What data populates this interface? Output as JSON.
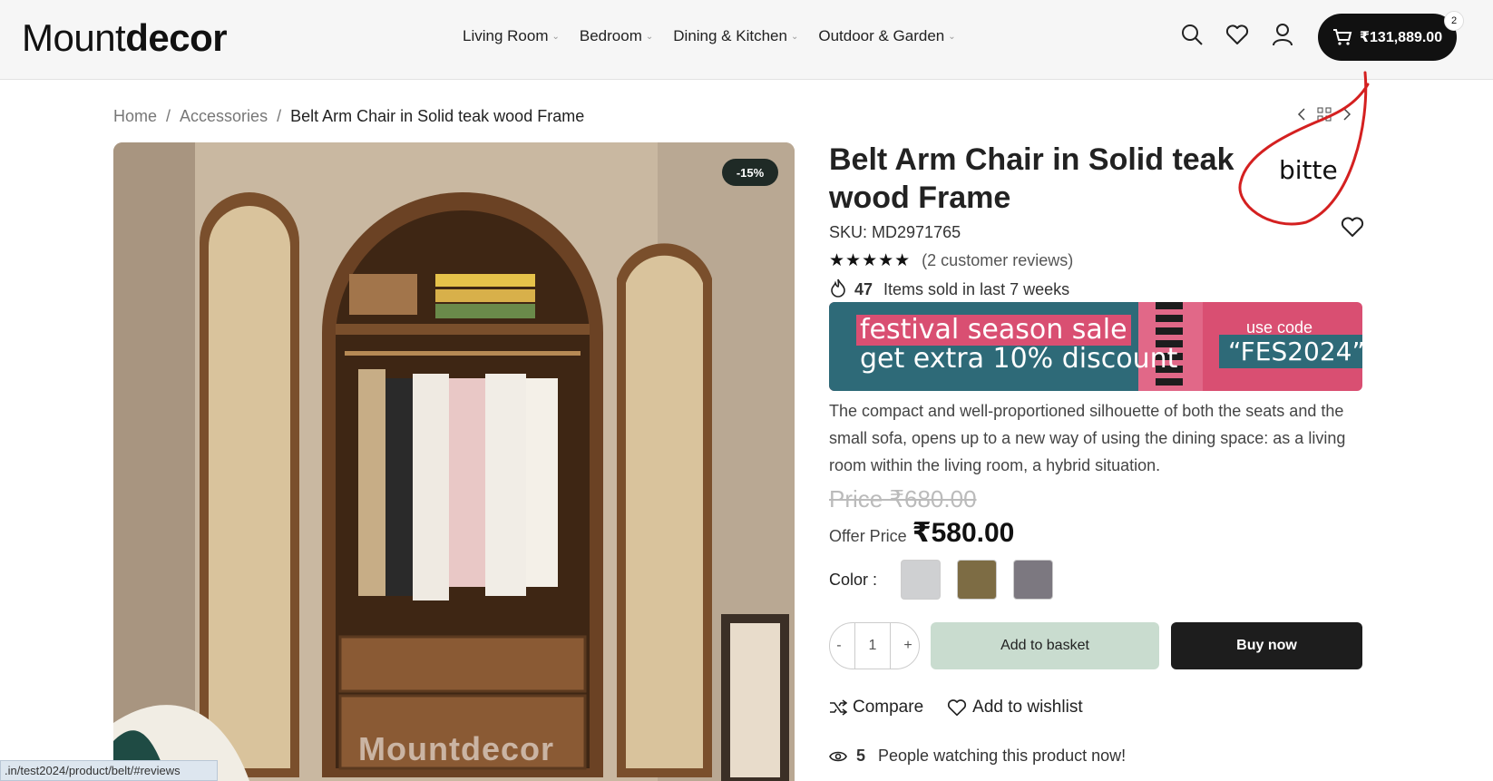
{
  "header": {
    "logo_light": "Mount",
    "logo_bold": "decor",
    "nav": [
      "Living Room",
      "Bedroom",
      "Dining & Kitchen",
      "Outdoor & Garden"
    ],
    "cart_total": "₹131,889.00",
    "cart_count": "2"
  },
  "breadcrumb": [
    "Home",
    "Accessories",
    "Belt Arm Chair in Solid teak wood Frame"
  ],
  "breadcrumb_sep": "/",
  "product": {
    "title": "Belt Arm Chair in Solid teak wood Frame",
    "badge": "-15%",
    "sku_label": "SKU:",
    "sku": "MD2971765",
    "stars": "★★★★★",
    "reviews": "(2 customer reviews)",
    "sold_count": "47",
    "sold_text": "Items sold in last 7 weeks",
    "banner": {
      "line1": "festival season sale",
      "line2": "get extra 10% discount",
      "code_label": "use code",
      "code": "“FES2024”"
    },
    "description": "The compact and well-proportioned silhouette of both the seats and the small sofa, opens up to a new way of using the dining space: as a living room within the living room, a hybrid situation.",
    "old_price": "Price ₹680.00",
    "offer_label": "Offer Price",
    "price": "₹580.00",
    "color_label": "Color :",
    "colors": [
      "#cfd0d2",
      "#7d6c44",
      "#7c7880"
    ],
    "qty": "1",
    "minus": "-",
    "plus": "+",
    "add_to_basket": "Add to basket",
    "buy_now": "Buy now",
    "compare": "Compare",
    "wishlist": "Add to wishlist",
    "watch_count": "5",
    "watch_text": "People watching this product now!",
    "watermark": "Mountdecor",
    "annotation": "bitte"
  },
  "status_url": ".in/test2024/product/belt/#reviews"
}
